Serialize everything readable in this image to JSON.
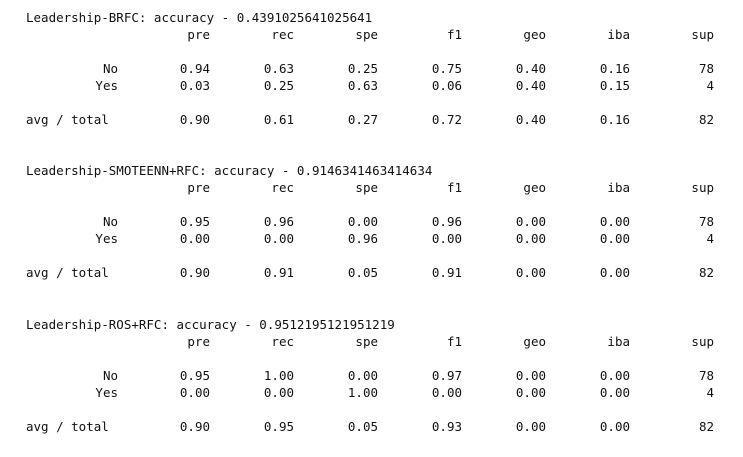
{
  "columns": [
    "pre",
    "rec",
    "spe",
    "f1",
    "geo",
    "iba",
    "sup"
  ],
  "reports": [
    {
      "title": "Leadership-BRFC: accuracy - 0.4391025641025641",
      "rows": [
        {
          "label": "No",
          "values": [
            "0.94",
            "0.63",
            "0.25",
            "0.75",
            "0.40",
            "0.16",
            "78"
          ]
        },
        {
          "label": "Yes",
          "values": [
            "0.03",
            "0.25",
            "0.63",
            "0.06",
            "0.40",
            "0.15",
            "4"
          ]
        }
      ],
      "avg": {
        "label": "avg / total",
        "values": [
          "0.90",
          "0.61",
          "0.27",
          "0.72",
          "0.40",
          "0.16",
          "82"
        ]
      }
    },
    {
      "title": "Leadership-SMOTEENN+RFC: accuracy - 0.9146341463414634",
      "rows": [
        {
          "label": "No",
          "values": [
            "0.95",
            "0.96",
            "0.00",
            "0.96",
            "0.00",
            "0.00",
            "78"
          ]
        },
        {
          "label": "Yes",
          "values": [
            "0.00",
            "0.00",
            "0.96",
            "0.00",
            "0.00",
            "0.00",
            "4"
          ]
        }
      ],
      "avg": {
        "label": "avg / total",
        "values": [
          "0.90",
          "0.91",
          "0.05",
          "0.91",
          "0.00",
          "0.00",
          "82"
        ]
      }
    },
    {
      "title": "Leadership-ROS+RFC: accuracy - 0.9512195121951219",
      "rows": [
        {
          "label": "No",
          "values": [
            "0.95",
            "1.00",
            "0.00",
            "0.97",
            "0.00",
            "0.00",
            "78"
          ]
        },
        {
          "label": "Yes",
          "values": [
            "0.00",
            "0.00",
            "1.00",
            "0.00",
            "0.00",
            "0.00",
            "4"
          ]
        }
      ],
      "avg": {
        "label": "avg / total",
        "values": [
          "0.90",
          "0.95",
          "0.05",
          "0.93",
          "0.00",
          "0.00",
          "82"
        ]
      }
    }
  ]
}
